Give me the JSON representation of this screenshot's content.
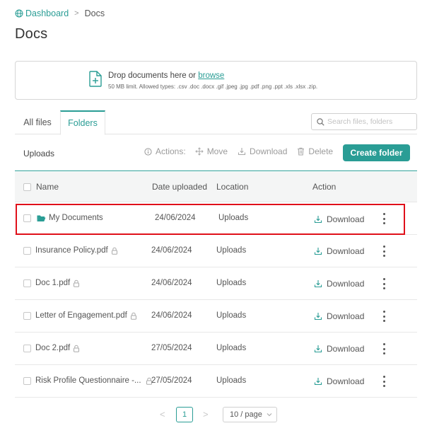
{
  "breadcrumb": {
    "home": "Dashboard",
    "separator": ">",
    "current": "Docs"
  },
  "page_title": "Docs",
  "upload": {
    "text": "Drop documents here or",
    "browse": "browse",
    "hint": "50 MB limit. Allowed types: .csv .doc .docx .gif .jpeg .jpg .pdf .png .ppt .xls .xlsx .zip."
  },
  "tabs": [
    {
      "label": "All files"
    },
    {
      "label": "Folders",
      "active": true
    }
  ],
  "search": {
    "placeholder": "Search files, folders"
  },
  "toolbar": {
    "title": "Uploads",
    "actions_label": "Actions:",
    "move": "Move",
    "download": "Download",
    "delete": "Delete",
    "create_folder": "Create folder"
  },
  "table": {
    "headers": {
      "name": "Name",
      "date": "Date uploaded",
      "location": "Location",
      "action": "Action"
    },
    "rows": [
      {
        "name": "My Documents",
        "type": "folder",
        "date": "24/06/2024",
        "location": "Uploads",
        "action": "Download",
        "locked": false
      },
      {
        "name": "Insurance Policy.pdf",
        "type": "file",
        "date": "24/06/2024",
        "location": "Uploads",
        "action": "Download",
        "locked": true
      },
      {
        "name": "Doc 1.pdf",
        "type": "file",
        "date": "24/06/2024",
        "location": "Uploads",
        "action": "Download",
        "locked": true
      },
      {
        "name": "Letter of Engagement.pdf",
        "type": "file",
        "date": "24/06/2024",
        "location": "Uploads",
        "action": "Download",
        "locked": true
      },
      {
        "name": "Doc 2.pdf",
        "type": "file",
        "date": "27/05/2024",
        "location": "Uploads",
        "action": "Download",
        "locked": true
      },
      {
        "name": "Risk Profile Questionnaire -...",
        "type": "file",
        "date": "27/05/2024",
        "location": "Uploads",
        "action": "Download",
        "locked": true
      }
    ]
  },
  "pagination": {
    "prev": "<",
    "current": "1",
    "next": ">",
    "page_size": "10 / page"
  },
  "colors": {
    "accent": "#2a9d95",
    "highlight": "#e0101a"
  },
  "icons": [
    "globe-icon",
    "file-plus-icon",
    "search-icon",
    "info-icon",
    "move-icon",
    "download-icon",
    "trash-icon",
    "folder-icon",
    "lock-icon",
    "more-vertical-icon",
    "chevron-down-icon"
  ]
}
